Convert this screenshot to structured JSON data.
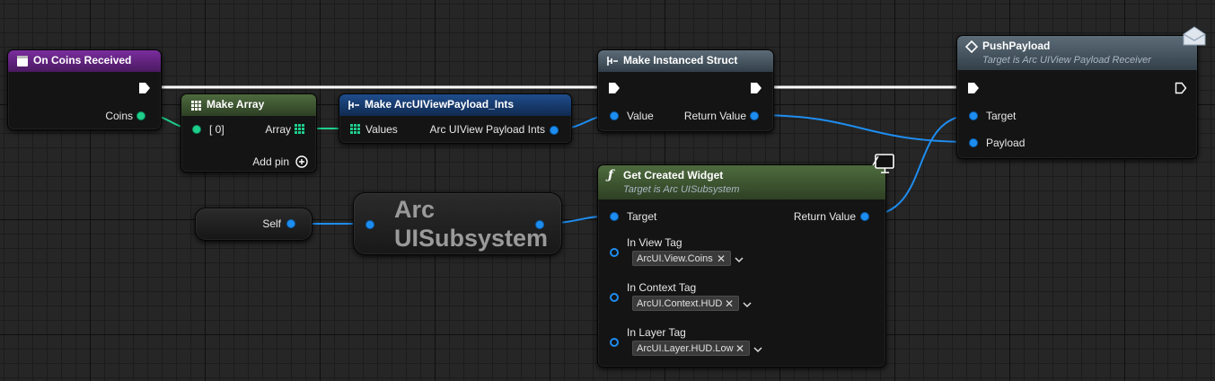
{
  "colors": {
    "event_header": "#7a2d9e",
    "pure_header": "#4e6b3e",
    "struct_header": "#1f4d8c",
    "call_header": "#5c6c78",
    "wire_blue": "#1e8df0",
    "wire_teal": "#1ecf8c",
    "wire_exec": "#ffffff"
  },
  "nodes": {
    "on_coins_received": {
      "title": "On Coins Received",
      "coins_pin": "Coins"
    },
    "make_array": {
      "title": "Make Array",
      "index_pin": "[ 0]",
      "array_pin": "Array",
      "add_pin": "Add pin",
      "icon": "array-grid-icon"
    },
    "make_payload": {
      "title": "Make ArcUIViewPayload_Ints",
      "values_pin": "Values",
      "output_pin": "Arc UIView Payload Ints"
    },
    "make_instanced_struct": {
      "title": "Make Instanced Struct",
      "value_pin": "Value",
      "return_pin": "Return Value"
    },
    "push_payload": {
      "title": "PushPayload",
      "subtitle": "Target is Arc UIView Payload Receiver",
      "target_pin": "Target",
      "payload_pin": "Payload"
    },
    "self_node": {
      "self_pin": "Self"
    },
    "subsystem": {
      "title_line1": "Arc",
      "title_line2": "UISubsystem"
    },
    "get_created_widget": {
      "title": "Get Created Widget",
      "subtitle": "Target is Arc UISubsystem",
      "target_pin": "Target",
      "return_pin": "Return Value",
      "view_tag_label": "In View Tag",
      "view_tag_value": "ArcUI.View.Coins",
      "context_tag_label": "In Context Tag",
      "context_tag_value": "ArcUI.Context.HUD",
      "layer_tag_label": "In Layer Tag",
      "layer_tag_value": "ArcUI.Layer.HUD.Low"
    }
  }
}
